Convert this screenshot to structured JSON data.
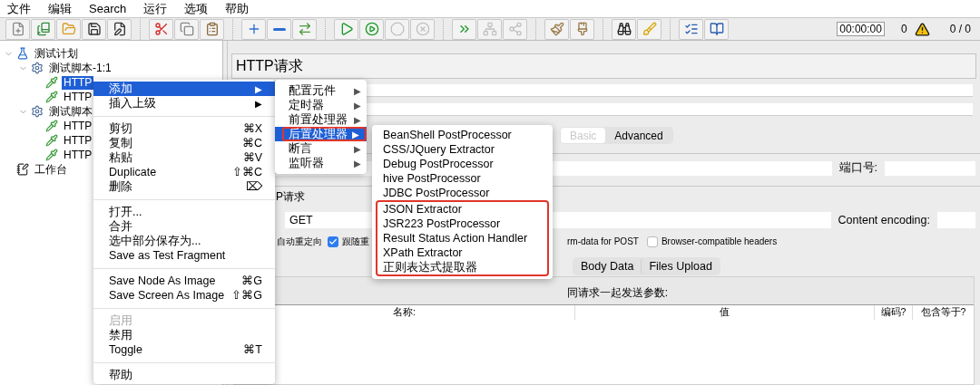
{
  "menubar": [
    "文件",
    "编辑",
    "Search",
    "运行",
    "选项",
    "帮助"
  ],
  "toolbar": [
    [
      {
        "kind": "new",
        "disabled": false
      },
      {
        "kind": "templates",
        "disabled": false
      },
      {
        "kind": "open",
        "disabled": false
      },
      {
        "kind": "save",
        "disabled": false
      },
      {
        "kind": "save-as",
        "disabled": false
      }
    ],
    [
      {
        "kind": "cut",
        "disabled": false
      },
      {
        "kind": "copy",
        "disabled": false
      },
      {
        "kind": "paste",
        "disabled": false
      }
    ],
    [
      {
        "kind": "expand",
        "disabled": false
      },
      {
        "kind": "collapse",
        "disabled": false
      },
      {
        "kind": "toggle",
        "disabled": false
      }
    ],
    [
      {
        "kind": "start",
        "disabled": false
      },
      {
        "kind": "start-no-pauses",
        "disabled": false
      },
      {
        "kind": "stop",
        "disabled": true
      },
      {
        "kind": "shutdown",
        "disabled": true
      }
    ],
    [
      {
        "kind": "remote-start",
        "disabled": false
      },
      {
        "kind": "remote-stop",
        "disabled": true
      },
      {
        "kind": "remote-exit",
        "disabled": true
      }
    ],
    [
      {
        "kind": "clear",
        "disabled": false
      },
      {
        "kind": "clear-all",
        "disabled": false
      }
    ],
    [
      {
        "kind": "search",
        "disabled": false
      },
      {
        "kind": "reset-search",
        "disabled": false
      }
    ],
    [
      {
        "kind": "function-helper",
        "disabled": false
      },
      {
        "kind": "help",
        "disabled": false
      }
    ]
  ],
  "timer": "00:00:00",
  "error_count": "0",
  "threads": "0 / 0",
  "tree": [
    {
      "label": "测试计划",
      "kind": "plan",
      "expanded": true,
      "selected": false,
      "children": [
        {
          "label": "测试脚本-1:1",
          "kind": "thread-group",
          "expanded": true,
          "selected": false,
          "children": [
            {
              "label": "HTTP",
              "kind": "sampler",
              "selected": true
            },
            {
              "label": "HTTP",
              "kind": "sampler",
              "selected": false
            }
          ]
        },
        {
          "label": "测试脚本",
          "kind": "thread-group",
          "expanded": true,
          "selected": false,
          "children": [
            {
              "label": "HTTP",
              "kind": "sampler",
              "selected": false
            },
            {
              "label": "HTTP",
              "kind": "sampler",
              "selected": false
            },
            {
              "label": "HTTP",
              "kind": "sampler",
              "selected": false
            }
          ]
        }
      ]
    },
    {
      "label": "工作台",
      "kind": "workbench",
      "selected": false
    }
  ],
  "panel": {
    "title": "HTTP请求",
    "tabs": [
      {
        "label": "Basic",
        "selected": true
      },
      {
        "label": "Advanced",
        "selected": false
      }
    ],
    "port_label": "端口号:",
    "section_label": "P请求",
    "method": "GET",
    "encoding_label": "Content encoding:",
    "options": [
      {
        "kind": "text",
        "label": "自动重定向"
      },
      {
        "kind": "checkbox",
        "label": "跟随重",
        "checked": true
      },
      {
        "kind": "text",
        "label": "rm-data for POST"
      },
      {
        "kind": "checkbox",
        "label": "Browser-compatible headers",
        "checked": false
      }
    ],
    "body_tabs": [
      {
        "label": "Body Data",
        "selected": false
      },
      {
        "label": "Files Upload",
        "selected": false
      }
    ],
    "params_title": "同请求一起发送参数:",
    "columns": [
      "名称:",
      "值",
      "编码?",
      "包含等于?"
    ]
  },
  "context_menu": [
    {
      "kind": "item",
      "label": "添加",
      "arrow": "▶",
      "highlighted": true,
      "disabled": false
    },
    {
      "kind": "item",
      "label": "插入上级",
      "arrow": "▶",
      "highlighted": false,
      "disabled": false
    },
    {
      "kind": "separator"
    },
    {
      "kind": "item",
      "label": "剪切",
      "shortcut": "⌘X",
      "highlighted": false,
      "disabled": false
    },
    {
      "kind": "item",
      "label": "复制",
      "shortcut": "⌘C",
      "highlighted": false,
      "disabled": false
    },
    {
      "kind": "item",
      "label": "粘贴",
      "shortcut": "⌘V",
      "highlighted": false,
      "disabled": false
    },
    {
      "kind": "item",
      "label": "Duplicate",
      "shortcut": "⇧⌘C",
      "highlighted": false,
      "disabled": false
    },
    {
      "kind": "item",
      "label": "删除",
      "shortcut": "⌦",
      "highlighted": false,
      "disabled": false
    },
    {
      "kind": "separator"
    },
    {
      "kind": "item",
      "label": "打开...",
      "highlighted": false,
      "disabled": false
    },
    {
      "kind": "item",
      "label": "合并",
      "highlighted": false,
      "disabled": false
    },
    {
      "kind": "item",
      "label": "选中部分保存为...",
      "highlighted": false,
      "disabled": false
    },
    {
      "kind": "item",
      "label": "Save as Test Fragment",
      "highlighted": false,
      "disabled": false
    },
    {
      "kind": "separator"
    },
    {
      "kind": "item",
      "label": "Save Node As Image",
      "shortcut": "⌘G",
      "highlighted": false,
      "disabled": false
    },
    {
      "kind": "item",
      "label": "Save Screen As Image",
      "shortcut": "⇧⌘G",
      "highlighted": false,
      "disabled": false
    },
    {
      "kind": "separator"
    },
    {
      "kind": "item",
      "label": "启用",
      "highlighted": false,
      "disabled": true
    },
    {
      "kind": "item",
      "label": "禁用",
      "highlighted": false,
      "disabled": false
    },
    {
      "kind": "item",
      "label": "Toggle",
      "shortcut": "⌘T",
      "highlighted": false,
      "disabled": false
    },
    {
      "kind": "separator"
    },
    {
      "kind": "item",
      "label": "帮助",
      "highlighted": false,
      "disabled": false
    }
  ],
  "submenu": [
    {
      "label": "配置元件",
      "arrow": "▶",
      "highlighted": false,
      "outlined": false
    },
    {
      "label": "定时器",
      "arrow": "▶",
      "highlighted": false,
      "outlined": false
    },
    {
      "label": "前置处理器",
      "arrow": "▶",
      "highlighted": false,
      "outlined": false
    },
    {
      "label": "后置处理器",
      "arrow": "▶",
      "highlighted": true,
      "outlined": true
    },
    {
      "label": "断言",
      "arrow": "▶",
      "highlighted": false,
      "outlined": false
    },
    {
      "label": "监听器",
      "arrow": "▶",
      "highlighted": false,
      "outlined": false
    }
  ],
  "submenu_2": [
    {
      "label": "BeanShell PostProcessor",
      "outlined": false
    },
    {
      "label": "CSS/JQuery Extractor",
      "outlined": false
    },
    {
      "label": "Debug PostProcessor",
      "outlined": false
    },
    {
      "label": "hive PostProcessor",
      "outlined": false
    },
    {
      "label": "JDBC PostProcessor",
      "outlined": false
    },
    {
      "label": "JSON Extractor",
      "outlined": true
    },
    {
      "label": "JSR223 PostProcessor",
      "outlined": true
    },
    {
      "label": "Result Status Action Handler",
      "outlined": true
    },
    {
      "label": "XPath Extractor",
      "outlined": true
    },
    {
      "label": "正则表达式提取器",
      "outlined": true
    }
  ]
}
